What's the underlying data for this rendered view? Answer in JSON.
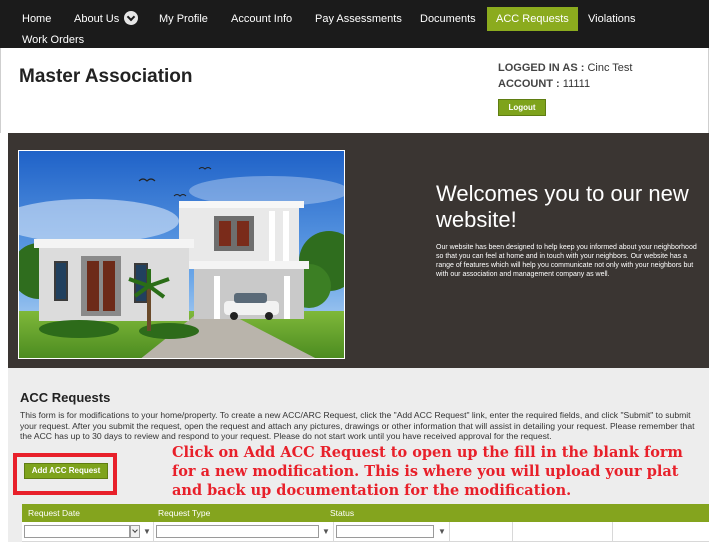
{
  "nav": {
    "items": [
      {
        "label": "Home"
      },
      {
        "label": "About Us"
      },
      {
        "label": "My Profile"
      },
      {
        "label": "Account Info"
      },
      {
        "label": "Pay Assessments"
      },
      {
        "label": "Documents"
      },
      {
        "label": "ACC Requests",
        "active": true
      },
      {
        "label": "Violations"
      },
      {
        "label": "Work Orders"
      }
    ]
  },
  "header": {
    "title": "Master Association",
    "logged_in_label": "LOGGED IN AS :",
    "logged_in_value": "Cinc Test",
    "account_label": "ACCOUNT :",
    "account_value": "11111",
    "logout_label": "Logout"
  },
  "hero": {
    "heading": "Welcomes you to our new website!",
    "body": "Our website has been designed to help keep you informed about your neighborhood so that you can feel at home and in touch with your neighbors. Our website has a range of features which will help you communicate not only with your neighbors but with our association and management company as well."
  },
  "acc": {
    "title": "ACC Requests",
    "description": "This form is for modifications to your home/property. To create a new ACC/ARC Request, click the \"Add ACC Request\" link, enter the required fields, and click \"Submit\" to submit your request. After you submit the request, open the request and attach any pictures, drawings or other information that will assist in detailing your request. Please remember that the ACC has up to 30 days to review and respond to your request. Please do not start work until you have received approval for the request.",
    "add_button_label": "Add ACC Request",
    "callout": "Click on Add ACC Request to open up the fill in the blank form for a new modification. This is where you will upload your plat and back up documentation for the modification.",
    "columns": [
      "Request Date",
      "Request Type",
      "Status"
    ]
  },
  "colors": {
    "nav_bg": "#1b1b1b",
    "accent_green": "#8bab1e",
    "hero_bg": "#3a3532",
    "callout_red": "#e8202a"
  }
}
